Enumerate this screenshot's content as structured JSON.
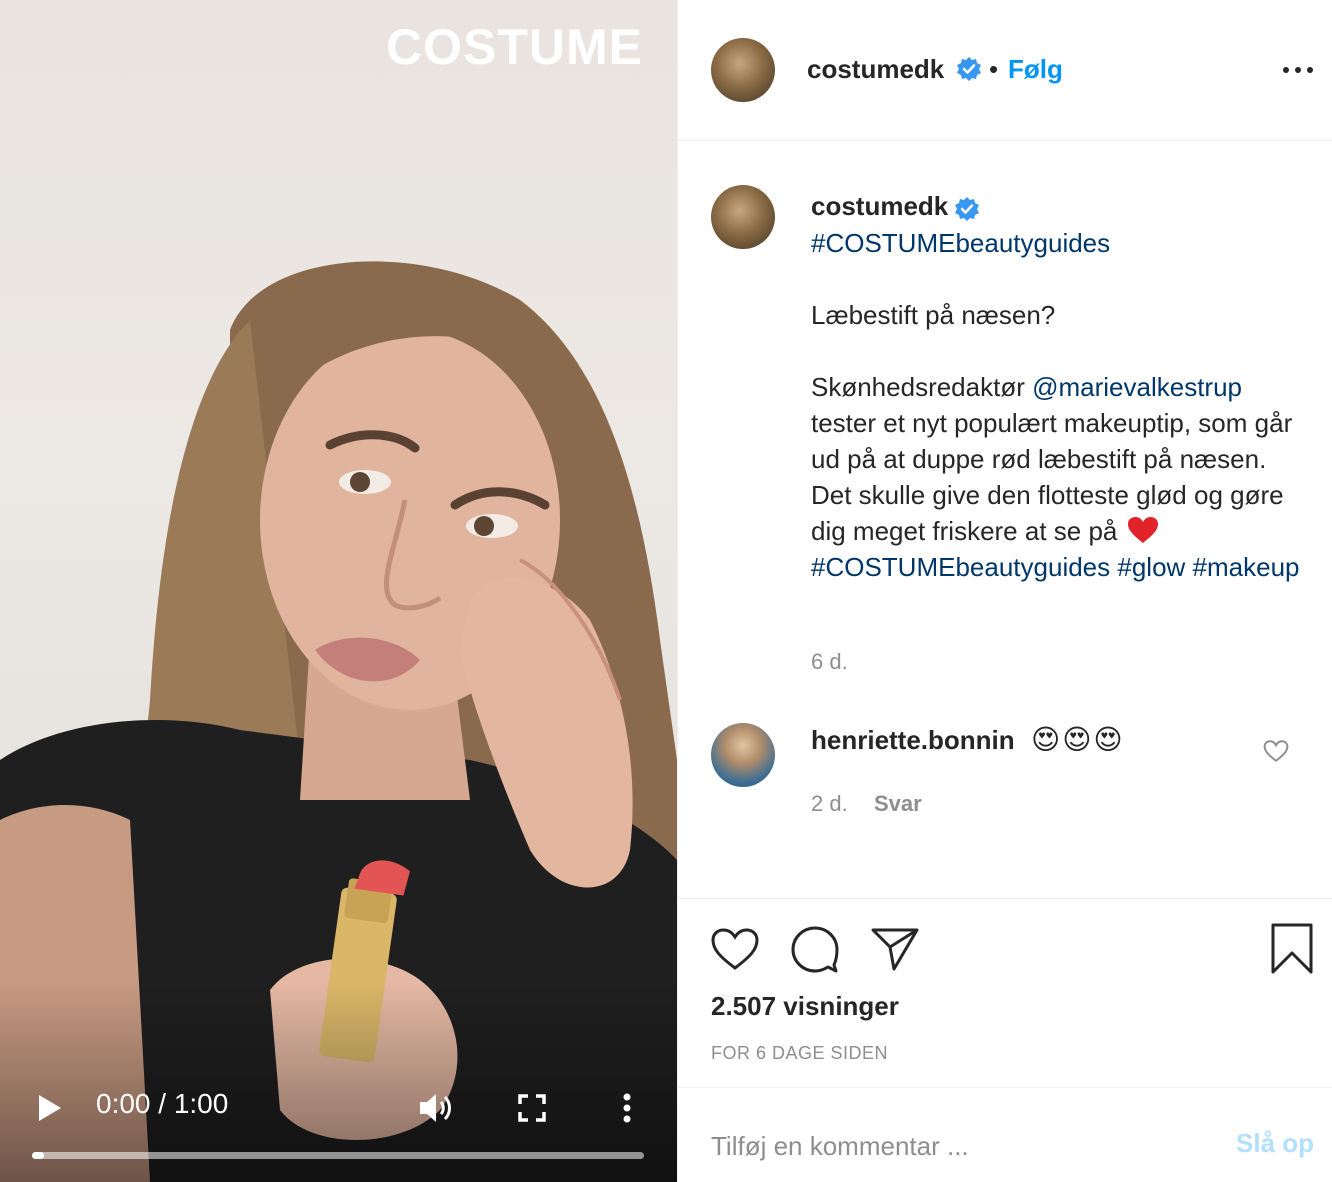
{
  "video": {
    "brand": "COSTUME",
    "time": "0:00 / 1:00",
    "progress": 0.02
  },
  "header": {
    "username": "costumedk",
    "separator": "•",
    "follow_label": "Følg"
  },
  "post": {
    "username": "costumedk",
    "caption": {
      "hashtag_top": "#COSTUMEbeautyguides",
      "question": "Læbestift på næsen?",
      "intro": "Skønhedsredaktør ",
      "mention": "@marievalkestrup",
      "body": " tester et nyt populært makeuptip, som går ud på at duppe rød læbestift på næsen. Det skulle give den flotteste glød og gøre dig meget friskere at se på ",
      "tags": [
        "#COSTUMEbeautyguides",
        "#glow",
        "#makeup"
      ]
    },
    "time": "6 d."
  },
  "comment": {
    "username": "henriette.bonnin",
    "text": "😍😍😍",
    "time": "2 d.",
    "reply_label": "Svar"
  },
  "actions": {
    "views": "2.507 visninger",
    "date": "FOR 6 DAGE SIDEN"
  },
  "comment_box": {
    "placeholder": "Tilføj en kommentar ...",
    "post_label": "Slå op"
  },
  "colors": {
    "link": "#00376b",
    "follow": "#0095f6",
    "verified": "#3897f0",
    "muted": "#8e8e8e",
    "post_disabled": "#b2dffc"
  },
  "icons": [
    "play-icon",
    "volume-icon",
    "fullscreen-icon",
    "more-vertical-icon",
    "verified-icon",
    "more-horizontal-icon",
    "heart-icon",
    "comment-icon",
    "share-icon",
    "bookmark-icon",
    "red-heart-emoji"
  ]
}
